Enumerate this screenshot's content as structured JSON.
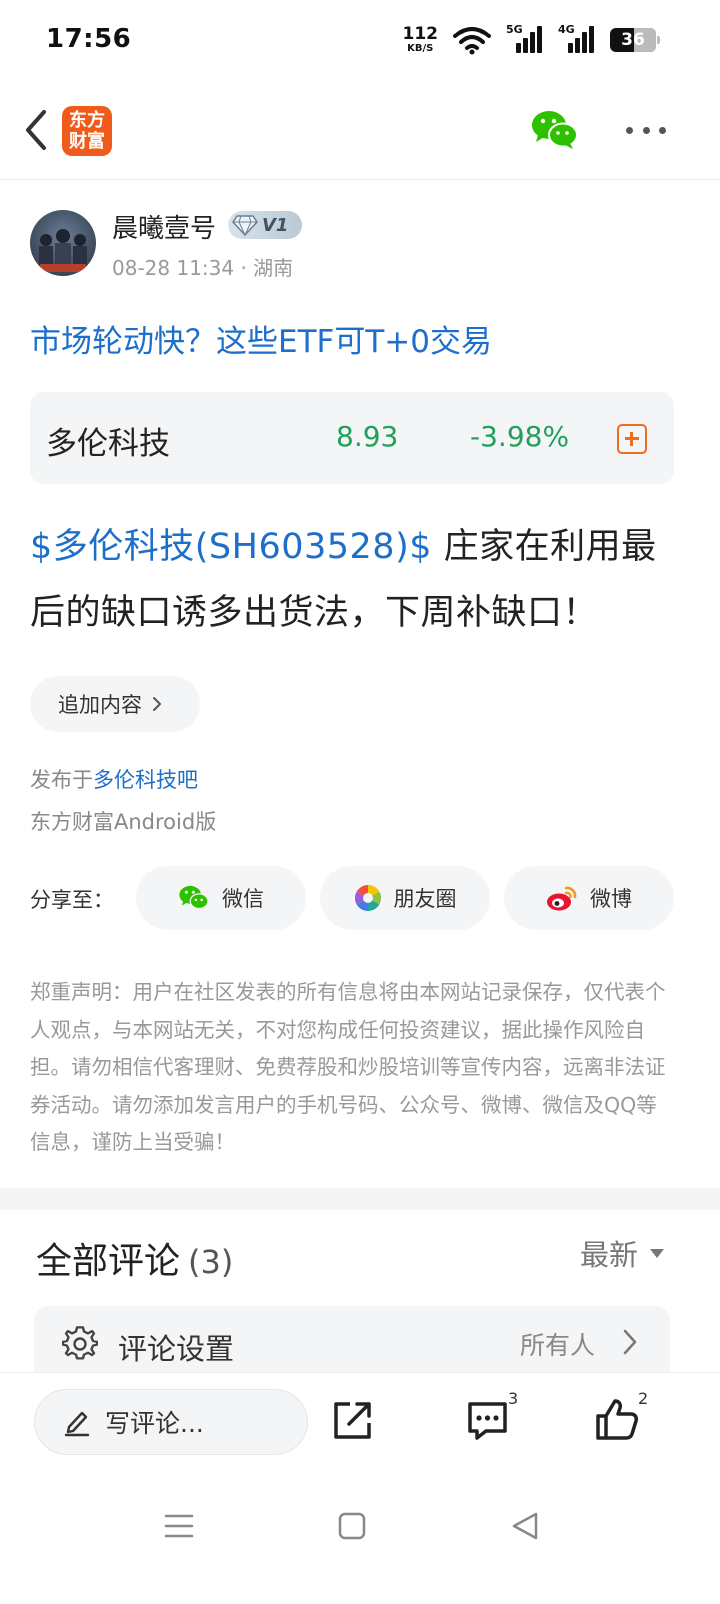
{
  "status_bar": {
    "time": "17:56",
    "net_speed_value": "112",
    "net_speed_unit": "KB/S",
    "signal1_label": "5G",
    "signal2_label": "4G",
    "battery_level": "36"
  },
  "nav": {
    "logo_line1": "东方",
    "logo_line2": "财富"
  },
  "post": {
    "author_name": "晨曦壹号",
    "badge_level": "V1",
    "meta": "08-28 11:34 · 湖南",
    "title_link": "市场轮动快？这些ETF可T+0交易",
    "stock": {
      "name": "多伦科技",
      "price": "8.93",
      "change": "-3.98%"
    },
    "body_tag": "$多伦科技(SH603528)$",
    "body_text": " 庄家在利用最后的缺口诱多出货法，下周补缺口！",
    "append_label": "追加内容",
    "published_prefix": "发布于",
    "published_bar": "多伦科技吧",
    "client": "东方财富Android版"
  },
  "share": {
    "label": "分享至：",
    "buttons": [
      {
        "label": "微信",
        "icon": "wechat-icon"
      },
      {
        "label": "朋友圈",
        "icon": "moments-icon"
      },
      {
        "label": "微博",
        "icon": "weibo-icon"
      }
    ]
  },
  "disclaimer": "郑重声明：用户在社区发表的所有信息将由本网站记录保存，仅代表个人观点，与本网站无关，不对您构成任何投资建议，据此操作风险自担。请勿相信代客理财、免费荐股和炒股培训等宣传内容，远离非法证券活动。请勿添加发言用户的手机号码、公众号、微博、微信及QQ等信息，谨防上当受骗！",
  "comments": {
    "title": "全部评论",
    "count": "(3)",
    "sort_label": "最新",
    "settings_label": "评论设置",
    "settings_value": "所有人"
  },
  "action_bar": {
    "write_placeholder": "写评论...",
    "comment_count": "3",
    "like_count": "2"
  },
  "colors": {
    "link_blue": "#1d6fc9",
    "stock_green": "#21a05a",
    "brand_orange": "#f05a1a"
  }
}
